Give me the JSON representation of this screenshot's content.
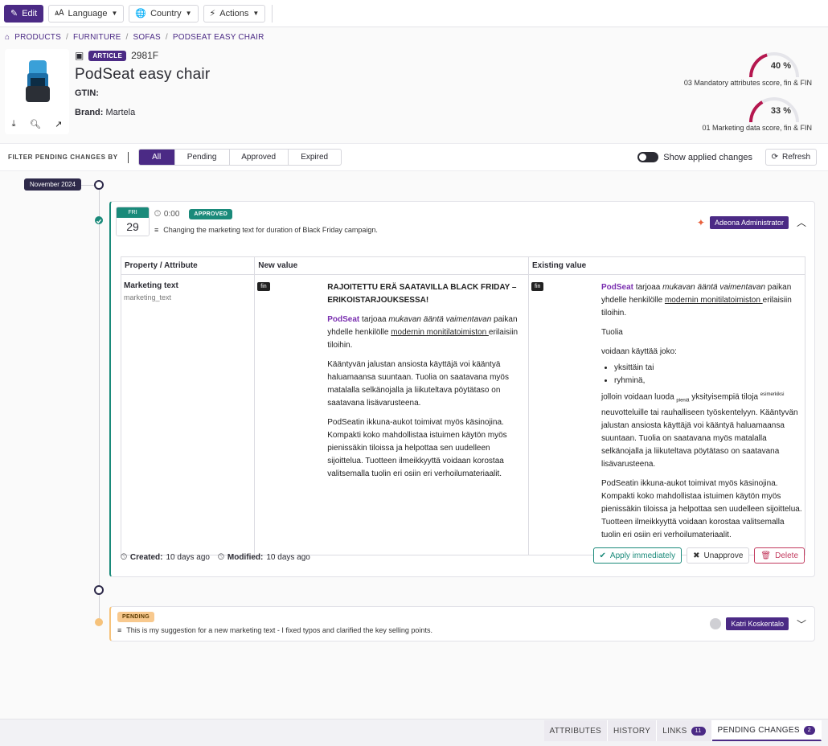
{
  "toolbar": {
    "edit": "Edit",
    "language": "Language",
    "country": "Country",
    "actions": "Actions"
  },
  "breadcrumb": [
    "PRODUCTS",
    "FURNITURE",
    "SOFAS",
    "PODSEAT EASY CHAIR"
  ],
  "product": {
    "type_badge": "ARTICLE",
    "code": "2981F",
    "title": "PodSeat easy chair",
    "gtin_label": "GTIN:",
    "gtin_value": "",
    "brand_label": "Brand:",
    "brand_value": "Martela"
  },
  "scores": [
    {
      "value_text": "40 %",
      "value": 40,
      "label": "03 Mandatory attributes score, fin & FIN",
      "color": "#b5174f"
    },
    {
      "value_text": "33 %",
      "value": 33,
      "label": "01 Marketing data score, fin & FIN",
      "color": "#b5174f"
    }
  ],
  "filter": {
    "label": "FILTER PENDING CHANGES BY",
    "options": [
      "All",
      "Pending",
      "Approved",
      "Expired"
    ],
    "selected": "All",
    "show_applied": "Show applied changes",
    "refresh": "Refresh"
  },
  "timeline": {
    "month": "November 2024"
  },
  "change1": {
    "dow": "FRI",
    "day": "29",
    "time": "0:00",
    "status": "APPROVED",
    "description": "Changing the marketing text for duration of Black Friday campaign.",
    "user": "Adeona Administrator",
    "table_headers": [
      "Property / Attribute",
      "New value",
      "Existing value"
    ],
    "attribute": "Marketing text",
    "attribute_key": "marketing_text",
    "lang": "fin",
    "new_heading": "RAJOITETTU ERÄ SAATAVILLA BLACK FRIDAY –ERIKOISTARJOUKSESSA!",
    "podseat": "PodSeat",
    "p1a": " tarjoaa ",
    "p1b": "mukavan ääntä vaimentavan",
    "p1c": " paikan yhdelle henkilölle ",
    "p1d": "modernin monitilatoimiston ",
    "p1e": "erilaisiin tiloihin.",
    "new_p2": "Kääntyvän jalustan ansiosta käyttäjä voi kääntyä haluamaansa suuntaan. Tuolia on saatavana myös matalalla selkänojalla ja liikuteltava pöytätaso on saatavana lisävarusteena.",
    "new_p3": "PodSeatin ikkuna-aukot toimivat myös käsinojina. Kompakti koko mahdollistaa istuimen käytön myös pienissäkin tiloissa ja helpottaa sen uudelleen sijoittelua. Tuotteen ilmeikkyyttä voidaan korostaa valitsemalla tuolin eri osiin eri verhoilumateriaalit.",
    "ex_tuolia": "Tuolia",
    "ex_voidaan": "voidaan käyttää joko:",
    "ex_li1": "yksittäin tai",
    "ex_li2": "ryhminä,",
    "ex_p3a": "jolloin voidaan luoda ",
    "ex_p3b": "pieniä",
    "ex_p3c": " yksityisempiä tiloja ",
    "ex_p3d": "esimerkiksi",
    "ex_p3e": " neuvotteluille tai rauhalliseen työskentelyyn. Kääntyvän jalustan ansiosta käyttäjä voi kääntyä haluamaansa suuntaan. Tuolia on saatavana myös matalalla selkänojalla ja liikuteltava pöytätaso on saatavana lisävarusteena.",
    "ex_p4": "PodSeatin ikkuna-aukot toimivat myös käsinojina. Kompakti koko mahdollistaa istuimen käytön myös pienissäkin tiloissa ja helpottaa sen uudelleen sijoittelua. Tuotteen ilmeikkyyttä voidaan korostaa valitsemalla tuolin eri osiin eri verhoilumateriaalit.",
    "created_label": "Created:",
    "created_value": "10 days ago",
    "modified_label": "Modified:",
    "modified_value": "10 days ago",
    "apply": "Apply immediately",
    "unapprove": "Unapprove",
    "delete": "Delete"
  },
  "change2": {
    "status": "PENDING",
    "description": "This is my suggestion for a new marketing text - I fixed typos and clarified the key selling points.",
    "user": "Katri Koskentalo"
  },
  "bottom_tabs": [
    {
      "label": "ATTRIBUTES",
      "count": ""
    },
    {
      "label": "HISTORY",
      "count": ""
    },
    {
      "label": "LINKS",
      "count": "11"
    },
    {
      "label": "PENDING CHANGES",
      "count": "2"
    }
  ]
}
